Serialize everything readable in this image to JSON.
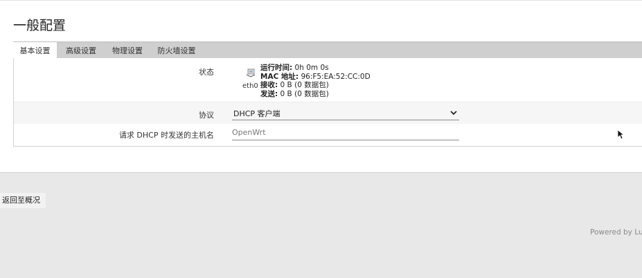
{
  "page": {
    "title": "一般配置"
  },
  "tabs": [
    {
      "label": "基本设置",
      "active": true
    },
    {
      "label": "高级设置",
      "active": false
    },
    {
      "label": "物理设置",
      "active": false
    },
    {
      "label": "防火墙设置",
      "active": false
    }
  ],
  "status": {
    "label": "状态",
    "device_name": "eth0",
    "device_icon": "network-port-icon",
    "uptime_key": "运行时间:",
    "uptime_value": " 0h 0m 0s",
    "mac_key": "MAC 地址:",
    "mac_value": " 96:F5:EA:52:CC:0D",
    "rx_key": "接收:",
    "rx_value": " 0 B (0 数据包)",
    "tx_key": "发送:",
    "tx_value": " 0 B (0 数据包)"
  },
  "protocol": {
    "label": "协议",
    "selected": "DHCP 客户端"
  },
  "hostname": {
    "label": "请求 DHCP 时发送的主机名",
    "placeholder": "OpenWrt",
    "value": ""
  },
  "actions": {
    "back_label": "返回至概况"
  },
  "footer": {
    "text": "Powered by LuCI"
  },
  "colors": {
    "tab_strip": "#cfcfcf",
    "active_tab": "#ffffff",
    "page_bg": "#e8e8e8"
  }
}
